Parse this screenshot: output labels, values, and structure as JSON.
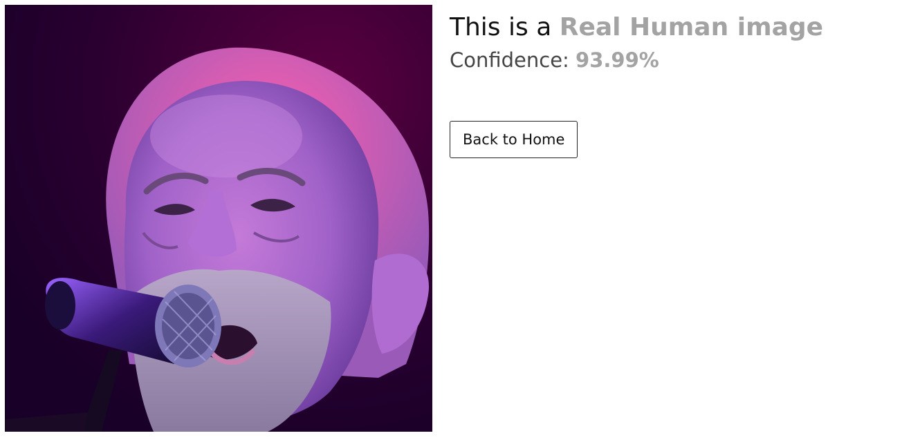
{
  "result": {
    "verdict_prefix": "This is a ",
    "verdict_label": "Real Human image",
    "confidence_prefix": "Confidence: ",
    "confidence_value": "93.99%"
  },
  "actions": {
    "back_label": "Back to Home"
  },
  "colors": {
    "accent_gray": "#a3a3a3",
    "photo_background": "#2a0024",
    "button_border": "#222222"
  }
}
